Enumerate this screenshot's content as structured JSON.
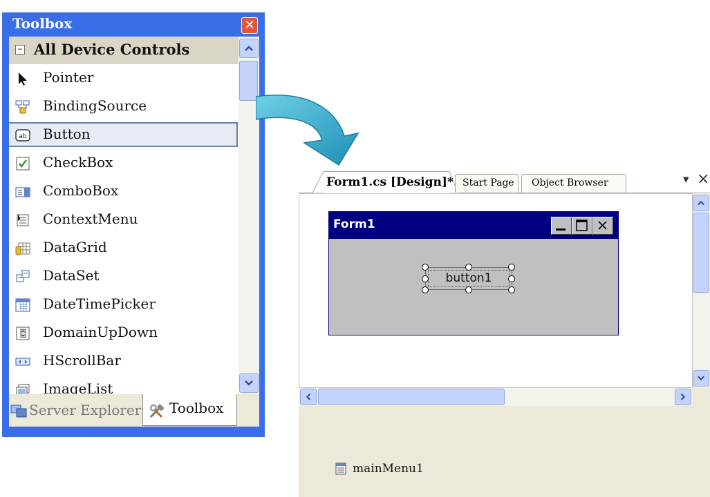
{
  "toolbox": {
    "title": "Toolbox",
    "category": "All Device Controls",
    "items": [
      {
        "label": "Pointer",
        "icon": "pointer-icon"
      },
      {
        "label": "BindingSource",
        "icon": "binding-source-icon"
      },
      {
        "label": "Button",
        "icon": "button-icon",
        "selected": true
      },
      {
        "label": "CheckBox",
        "icon": "checkbox-icon"
      },
      {
        "label": "ComboBox",
        "icon": "combobox-icon"
      },
      {
        "label": "ContextMenu",
        "icon": "context-menu-icon"
      },
      {
        "label": "DataGrid",
        "icon": "datagrid-icon"
      },
      {
        "label": "DataSet",
        "icon": "dataset-icon"
      },
      {
        "label": "DateTimePicker",
        "icon": "datetime-picker-icon"
      },
      {
        "label": "DomainUpDown",
        "icon": "domain-updown-icon"
      },
      {
        "label": "HScrollBar",
        "icon": "hscrollbar-icon"
      },
      {
        "label": "ImageList",
        "icon": "imagelist-icon"
      }
    ],
    "tabs": [
      {
        "label": "Server Explorer",
        "icon": "server-explorer-icon",
        "active": false
      },
      {
        "label": "Toolbox",
        "icon": "toolbox-tools-icon",
        "active": true
      }
    ],
    "colors": {
      "title_bar": "#3a6ee8",
      "close": "#e0583a"
    }
  },
  "designer": {
    "tabs": [
      {
        "label": "Form1.cs [Design]*",
        "active": true
      },
      {
        "label": "Start Page",
        "active": false
      },
      {
        "label": "Object Browser",
        "active": false
      }
    ],
    "form": {
      "title": "Form1",
      "button_label": "button1",
      "colors": {
        "title_bar": "#000080",
        "client": "#c0c0c0"
      }
    },
    "tray": {
      "component": "mainMenu1",
      "icon": "main-menu-icon"
    }
  }
}
